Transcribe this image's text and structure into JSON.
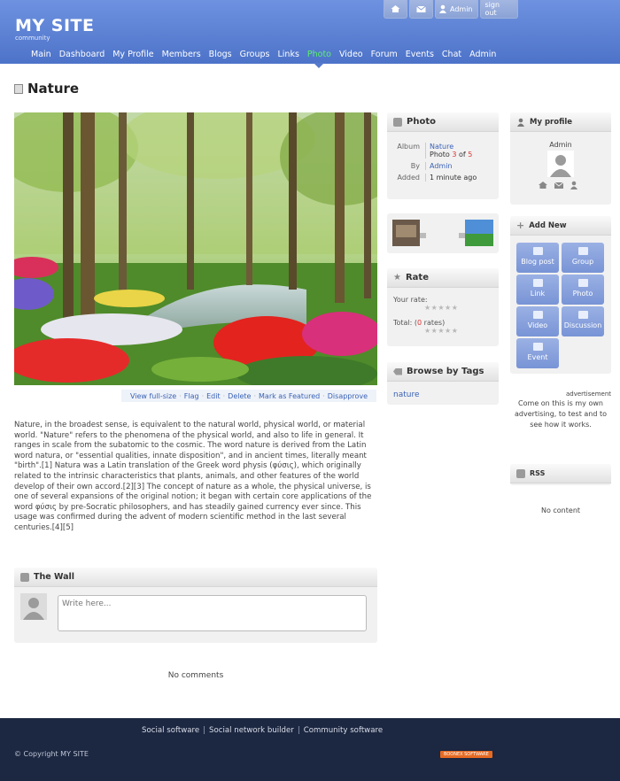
{
  "header": {
    "site_title": "MY SITE",
    "site_subtitle": "community",
    "top_buttons": {
      "home_icon": "home-icon",
      "mail_icon": "mail-icon",
      "user_icon": "user-icon",
      "admin": "Admin",
      "signout": "sign out"
    },
    "nav": [
      "Main",
      "Dashboard",
      "My Profile",
      "Members",
      "Blogs",
      "Groups",
      "Links",
      "Photo",
      "Video",
      "Forum",
      "Events",
      "Chat",
      "Admin"
    ],
    "active_nav": "Photo",
    "active_color": "#5cf06b",
    "brand_color": "#5a7fd2"
  },
  "page": {
    "title": "Nature",
    "photo_actions": [
      "View full-size",
      "Flag",
      "Edit",
      "Delete",
      "Mark as Featured",
      "Disapprove"
    ],
    "description": "Nature, in the broadest sense, is equivalent to the natural world, physical world, or material world. \"Nature\" refers to the phenomena of the physical world, and also to life in general. It ranges in scale from the subatomic to the cosmic. The word nature is derived from the Latin word natura, or \"essential qualities, innate disposition\", and in ancient times, literally meant \"birth\".[1] Natura was a Latin translation of the Greek word physis (φύσις), which originally related to the intrinsic characteristics that plants, animals, and other features of the world develop of their own accord.[2][3] The concept of nature as a whole, the physical universe, is one of several expansions of the original notion; it began with certain core applications of the word φύσις by pre-Socratic philosophers, and has steadily gained currency ever since. This usage was confirmed during the advent of modern scientific method in the last several centuries.[4][5]"
  },
  "wall": {
    "title": "The Wall",
    "placeholder": "Write here...",
    "no_comments": "No comments"
  },
  "photo_info": {
    "title": "Photo",
    "album_label": "Album",
    "album_value": "Nature",
    "photo_word": "Photo",
    "photo_index": "3",
    "of_word": "of",
    "photo_total": "5",
    "by_label": "By",
    "by_value": "Admin",
    "added_label": "Added",
    "added_value": "1 minute ago"
  },
  "rate": {
    "title": "Rate",
    "your_rate": "Your rate:",
    "total_prefix": "Total: (",
    "total_count": "0",
    "total_suffix": " rates)",
    "stars": "★★★★★"
  },
  "tags": {
    "title": "Browse by Tags",
    "items": [
      "nature"
    ]
  },
  "profile": {
    "title": "My profile",
    "name": "Admin"
  },
  "add_new": {
    "title": "Add New",
    "buttons": [
      "Blog post",
      "Group",
      "Link",
      "Photo",
      "Video",
      "Discussion",
      "Event"
    ]
  },
  "advertisement": {
    "label": "advertisement",
    "text": "Come on this is my own advertising, to test and to see how it works."
  },
  "rss": {
    "title": "RSS",
    "empty": "No content"
  },
  "footer": {
    "links": [
      "Social software",
      "Social network builder",
      "Community software"
    ],
    "copyright": "© Copyright MY SITE",
    "badge": "BOONEX SOFTWARE"
  }
}
